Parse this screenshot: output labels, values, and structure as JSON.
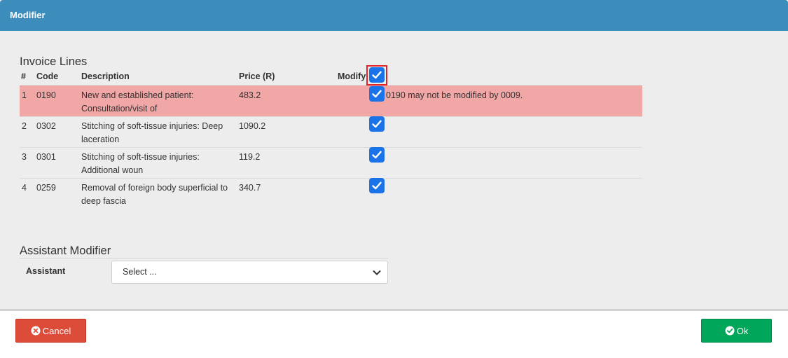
{
  "header": {
    "title": "Modifier"
  },
  "invoice": {
    "title": "Invoice Lines",
    "columns": {
      "num": "#",
      "code": "Code",
      "description": "Description",
      "price": "Price (R)",
      "modify": "Modify"
    },
    "modify_all_checked": true,
    "rows": [
      {
        "num": "1",
        "code": "0190",
        "description": "New and established patient: Consultation/visit of",
        "price": "483.2",
        "checked": true,
        "message": "0190 may not be modified by 0009."
      },
      {
        "num": "2",
        "code": "0302",
        "description": "Stitching of soft-tissue injuries: Deep laceration",
        "price": "1090.2",
        "checked": true,
        "message": ""
      },
      {
        "num": "3",
        "code": "0301",
        "description": "Stitching of soft-tissue injuries: Additional woun",
        "price": "119.2",
        "checked": true,
        "message": ""
      },
      {
        "num": "4",
        "code": "0259",
        "description": "Removal of foreign body superficial to deep fascia",
        "price": "340.7",
        "checked": true,
        "message": ""
      }
    ]
  },
  "assistant": {
    "title": "Assistant Modifier",
    "label": "Assistant",
    "select_value": "Select ..."
  },
  "footer": {
    "cancel_label": "Cancel",
    "ok_label": "Ok"
  },
  "colors": {
    "header": "#3c8dbc",
    "error_row": "#f2a7a7",
    "checkbox": "#1a73e8",
    "cancel": "#dd4b39",
    "ok": "#00a65a"
  }
}
